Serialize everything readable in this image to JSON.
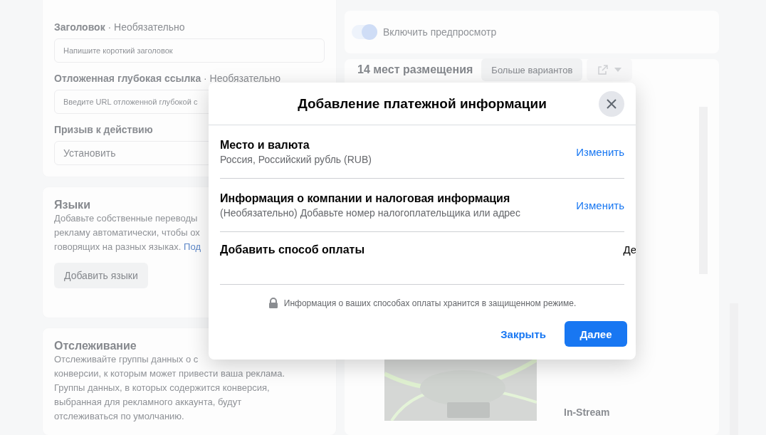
{
  "headline_field": {
    "label": "Заголовок",
    "optional": "· Необязательно",
    "placeholder": "Напишите короткий заголовок"
  },
  "deeplink_field": {
    "label": "Отложенная глубокая ссылка",
    "optional": "· Необязательно",
    "placeholder": "Введите URL отложенной глубокой с"
  },
  "cta_field": {
    "label": "Призыв к действию",
    "value": "Установить"
  },
  "languages": {
    "title": "Языки",
    "lines": [
      "Добавьте собственные переводы",
      "рекламу автоматически, чтобы ох"
    ],
    "last_line": "говорящих на разных языках.",
    "link": "Под",
    "button": "Добавить языки"
  },
  "tracking": {
    "title": "Отслеживание",
    "lines": [
      "Отслеживайте группы данных о с",
      "конверсии, к которым может привести ваша реклама.",
      "Группы данных, в которых содержится конверсия,",
      "выбранная для рекламного аккаунта, будут",
      "отслеживаться по умолчанию."
    ]
  },
  "preview_toggle": {
    "label": "Включить предпросмотр",
    "on": true
  },
  "placements": {
    "title": "14 мест размещения",
    "more_button": "Больше вариантов",
    "in_stream": "In-Stream"
  },
  "dialog": {
    "title": "Добавление платежной информации",
    "sections": [
      {
        "title": "Место и валюта",
        "subtitle": "Россия, Российский рубль (RUB)",
        "action": "Изменить"
      },
      {
        "title": "Информация о компании и налоговая информация",
        "subtitle": "(Необязательно) Добавьте номер налогоплательщика или адрес",
        "action": "Изменить"
      },
      {
        "title": "Добавить способ оплаты",
        "action": "Де"
      }
    ],
    "secure_note": "Информация о ваших способах оплаты хранится в защищенном режиме.",
    "buttons": [
      {
        "label": "Закрыть",
        "kind": "link"
      },
      {
        "label": "Далее",
        "kind": "primary"
      }
    ]
  }
}
